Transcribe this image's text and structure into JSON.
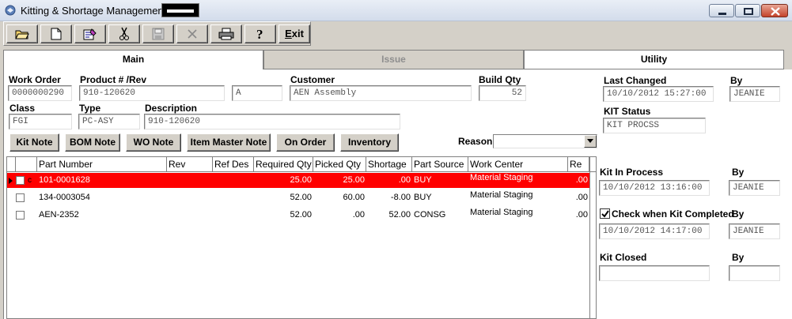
{
  "window": {
    "title": "Kitting & Shortage Management"
  },
  "toolbar": {
    "exit_label": "Exit"
  },
  "tabs": [
    {
      "label": "Main",
      "state": "active"
    },
    {
      "label": "Issue",
      "state": "disabled"
    },
    {
      "label": "Utility",
      "state": "normal"
    }
  ],
  "header": {
    "work_order_label": "Work Order",
    "work_order": "0000000290",
    "product_label": "Product # /Rev",
    "product": "910-120620",
    "rev": "A",
    "customer_label": "Customer",
    "customer": "AEN Assembly",
    "build_qty_label": "Build Qty",
    "build_qty": "52",
    "class_label": "Class",
    "class": "FGI",
    "type_label": "Type",
    "type": "PC-ASY",
    "description_label": "Description",
    "description": "910-120620"
  },
  "buttons": {
    "kit_note": "Kit Note",
    "bom_note": "BOM Note",
    "wo_note": "WO Note",
    "item_master_note": "Item Master Note",
    "on_order": "On Order",
    "inventory": "Inventory"
  },
  "reason": {
    "label": "Reason",
    "value": ""
  },
  "grid": {
    "columns": [
      "Part Number",
      "Rev",
      "Ref Des",
      "Required Qty",
      "Picked Qty",
      "Shortage",
      "Part Source",
      "Work Center",
      "Re"
    ],
    "rows": [
      {
        "part_number": "101-0001628",
        "rev": "",
        "ref_des": "",
        "required_qty": "25.00",
        "picked_qty": "25.00",
        "shortage": ".00",
        "part_source": "BUY",
        "work_center": "Material Staging",
        "re": ".00",
        "row_marker": "c",
        "selected": true
      },
      {
        "part_number": "134-0003054",
        "rev": "",
        "ref_des": "",
        "required_qty": "52.00",
        "picked_qty": "60.00",
        "shortage": "-8.00",
        "part_source": "BUY",
        "work_center": "Material Staging",
        "re": ".00",
        "row_marker": "",
        "selected": false
      },
      {
        "part_number": "AEN-2352",
        "rev": "",
        "ref_des": "",
        "required_qty": "52.00",
        "picked_qty": ".00",
        "shortage": "52.00",
        "part_source": "CONSG",
        "work_center": "Material Staging",
        "re": ".00",
        "row_marker": "",
        "selected": false
      }
    ]
  },
  "side": {
    "last_changed_label": "Last Changed",
    "last_changed": "10/10/2012 15:27:00",
    "last_changed_by_label": "By",
    "last_changed_by": "JEANIE",
    "kit_status_label": "KIT Status",
    "kit_status": "KIT PROCSS",
    "kit_in_process_label": "Kit In Process",
    "kit_in_process": "10/10/2012 13:16:00",
    "kit_in_process_by_label": "By",
    "kit_in_process_by": "JEANIE",
    "check_completed_label": "Check when Kit Completed",
    "check_completed": true,
    "completed_by_label": "By",
    "completed_date": "10/10/2012 14:17:00",
    "completed_by": "JEANIE",
    "kit_closed_label": "Kit Closed",
    "kit_closed": "",
    "kit_closed_by_label": "By",
    "kit_closed_by": ""
  }
}
